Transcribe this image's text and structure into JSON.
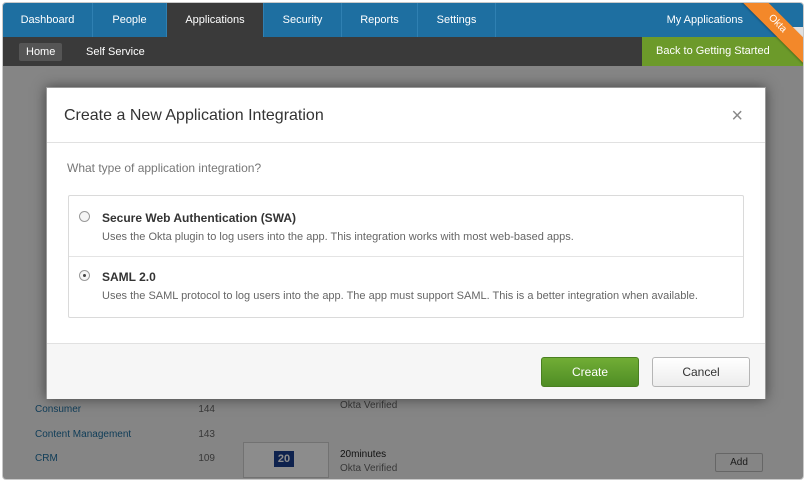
{
  "topnav": {
    "tabs": [
      "Dashboard",
      "People",
      "Applications",
      "Security",
      "Reports",
      "Settings"
    ],
    "active": "Applications",
    "my_apps": "My Applications"
  },
  "subnav": {
    "home": "Home",
    "self_service": "Self Service",
    "getting_started": "Back to Getting Started"
  },
  "okta_badge": "Okta",
  "background": {
    "sidebar": [
      {
        "label": "Consumer",
        "count": "144"
      },
      {
        "label": "Content Management",
        "count": "143"
      },
      {
        "label": "CRM",
        "count": "109"
      }
    ],
    "app": {
      "logo": "20",
      "name": "20minutes",
      "verified": "Okta Verified",
      "verified_prev": "Okta Verified",
      "add": "Add"
    }
  },
  "modal": {
    "title": "Create a New Application Integration",
    "close": "×",
    "question": "What type of application integration?",
    "options": [
      {
        "title": "Secure Web Authentication (SWA)",
        "desc": "Uses the Okta plugin to log users into the app. This integration works with most web-based apps.",
        "selected": false
      },
      {
        "title": "SAML 2.0",
        "desc": "Uses the SAML protocol to log users into the app. The app must support SAML. This is a better integration when available.",
        "selected": true
      }
    ],
    "create": "Create",
    "cancel": "Cancel"
  },
  "colors": {
    "nav": "#1e6fa1",
    "subnav": "#3a3a3a",
    "accent_green": "#5a9a2c",
    "okta_orange": "#f3882a"
  }
}
